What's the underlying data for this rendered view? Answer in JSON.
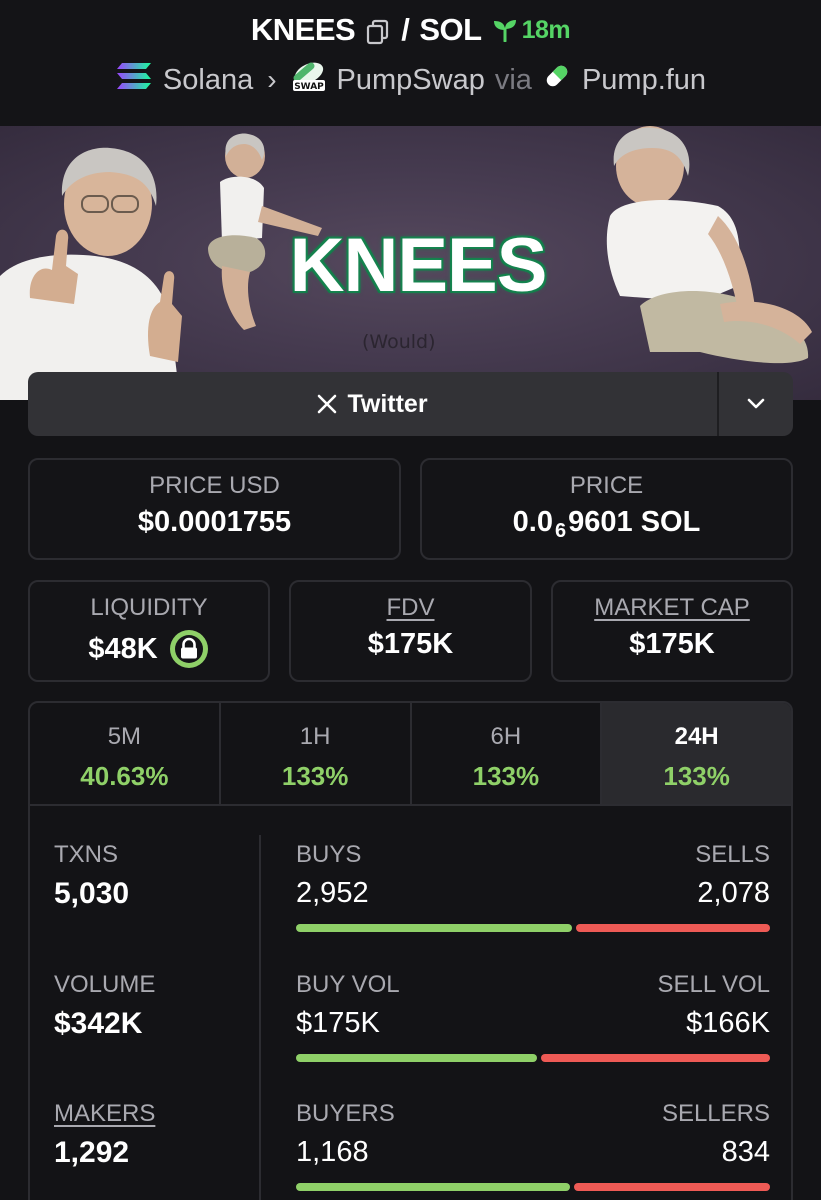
{
  "header": {
    "token": "KNEES",
    "separator": "/",
    "quote": "SOL",
    "age": "18m",
    "chain": "Solana",
    "dex": "PumpSwap",
    "dex_badge": "SWAP",
    "via": "via",
    "launchpad": "Pump.fun"
  },
  "banner": {
    "title": "KNEES",
    "subtitle": "(Would)"
  },
  "social": {
    "twitter_label": "Twitter"
  },
  "stats": {
    "price_usd_label": "PRICE USD",
    "price_usd": "$0.0001755",
    "price_label": "PRICE",
    "price_prefix": "0.0",
    "price_zeros": "6",
    "price_suffix": "9601 SOL",
    "liquidity_label": "LIQUIDITY",
    "liquidity": "$48K",
    "fdv_label": "FDV",
    "fdv": "$175K",
    "mcap_label": "MARKET CAP",
    "mcap": "$175K"
  },
  "timeframes": [
    {
      "label": "5M",
      "change": "40.63%"
    },
    {
      "label": "1H",
      "change": "133%"
    },
    {
      "label": "6H",
      "change": "133%"
    },
    {
      "label": "24H",
      "change": "133%"
    }
  ],
  "activity": {
    "txns_label": "TXNS",
    "txns": "5,030",
    "buys_label": "BUYS",
    "buys": "2,952",
    "sells_label": "SELLS",
    "sells": "2,078",
    "buys_ratio": 0.587,
    "volume_label": "VOLUME",
    "volume": "$342K",
    "buy_vol_label": "BUY VOL",
    "buy_vol": "$175K",
    "sell_vol_label": "SELL VOL",
    "sell_vol": "$166K",
    "buy_vol_ratio": 0.513,
    "makers_label": "MAKERS",
    "makers": "1,292",
    "buyers_label": "BUYERS",
    "buyers": "1,168",
    "sellers_label": "SELLERS",
    "sellers": "834",
    "buyers_ratio": 0.583
  },
  "colors": {
    "positive": "#8fd068",
    "negative": "#ee5a55",
    "age": "#55d465",
    "background": "#131316"
  }
}
